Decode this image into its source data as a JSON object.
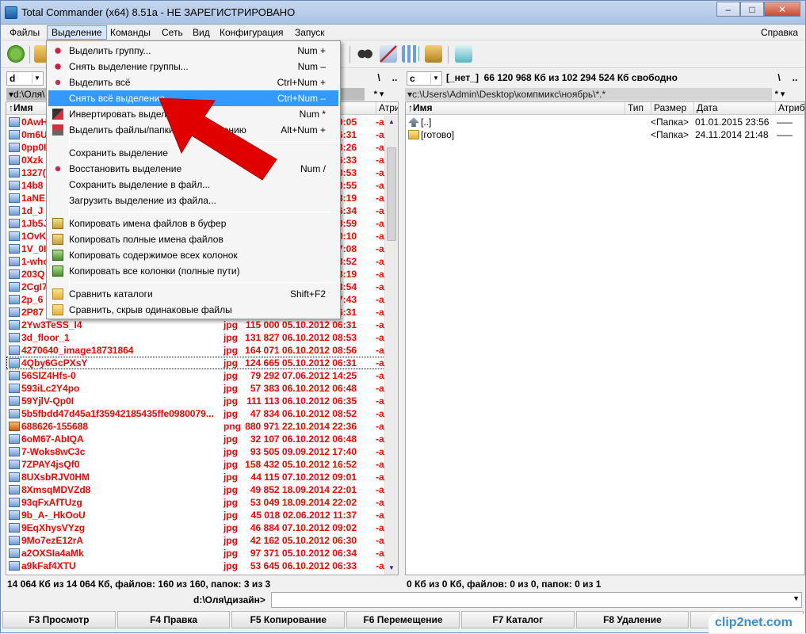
{
  "window": {
    "title": "Total Commander (x64) 8.51a - НЕ ЗАРЕГИСТРИРОВАНО",
    "minimize": "–",
    "maximize": "□",
    "close": "✕"
  },
  "menubar": [
    "Файлы",
    "Выделение",
    "Команды",
    "Сеть",
    "Вид",
    "Конфигурация",
    "Запуск",
    "Справка"
  ],
  "left_drive": {
    "letter": "d",
    "back": "\\",
    "up": ".."
  },
  "right_drive": {
    "letter": "c",
    "label": "[_нет_]",
    "free": "66 120 968 Кб из 102 294 524 Кб свободно",
    "back": "\\",
    "up": ".."
  },
  "left_path": "▾d:\\Оля\\",
  "left_path_right": "* ▾",
  "right_path": "▾c:\\Users\\Admin\\Desktop\\компмикс\\ноябрь\\*.*",
  "right_path_right": "* ▾",
  "left_columns": {
    "name": "↑Имя",
    "attr": "Атри"
  },
  "right_columns": {
    "name": "↑Имя",
    "type": "Тип",
    "size": "Размер",
    "date": "Дата",
    "attr": "Атрибу"
  },
  "left_rows": [
    {
      "name": "0AwH",
      "ext": "",
      "size": "",
      "date": "2012 09:05",
      "attr": "-a-"
    },
    {
      "name": "0m6U",
      "ext": "",
      "size": "",
      "date": "2012 06:31",
      "attr": "-a-"
    },
    {
      "name": "0pp0I",
      "ext": "",
      "size": "",
      "date": "2012 08:26",
      "attr": "-a-"
    },
    {
      "name": "0Xzk",
      "ext": "",
      "size": "",
      "date": "2012 06:33",
      "attr": "-a-"
    },
    {
      "name": "1327(",
      "ext": "",
      "size": "",
      "date": "2012 08:53",
      "attr": "-a-"
    },
    {
      "name": "14b8",
      "ext": "",
      "size": "",
      "date": "2012 08:55",
      "attr": "-a-"
    },
    {
      "name": "1aNE",
      "ext": "",
      "size": "",
      "date": "3 13:19",
      "attr": "-a-"
    },
    {
      "name": "1d_J",
      "ext": "",
      "size": "",
      "date": "2012 06:34",
      "attr": "-a-"
    },
    {
      "name": "1Jb5J",
      "ext": "",
      "size": "",
      "date": "2012 08:59",
      "attr": "-a-"
    },
    {
      "name": "1OvK",
      "ext": "",
      "size": "",
      "date": "2014 20:10",
      "attr": "-a-"
    },
    {
      "name": "1V_0I",
      "ext": "",
      "size": "",
      "date": "2012 07:08",
      "attr": "-a-"
    },
    {
      "name": "1-who",
      "ext": "",
      "size": "",
      "date": "2012 08:52",
      "attr": "-a-"
    },
    {
      "name": "203Q",
      "ext": "",
      "size": "",
      "date": "2012 08:19",
      "attr": "-a-"
    },
    {
      "name": "2CgI7",
      "ext": "",
      "size": "",
      "date": "2012 08:54",
      "attr": "-a-"
    },
    {
      "name": "2p_6",
      "ext": "",
      "size": "",
      "date": "2012 17:43",
      "attr": "-a-"
    },
    {
      "name": "2P87",
      "ext": "",
      "size": "",
      "date": "2012 06:31",
      "attr": "-a-"
    },
    {
      "name": "2Yw3TeSS_I4",
      "ext": "jpg",
      "size": "115 000",
      "date": "05.10.2012 06:31",
      "attr": "-a-"
    },
    {
      "name": "3d_floor_1",
      "ext": "jpg",
      "size": "131 827",
      "date": "06.10.2012 08:53",
      "attr": "-a-"
    },
    {
      "name": "4270640_image18731864",
      "ext": "jpg",
      "size": "164 071",
      "date": "06.10.2012 08:56",
      "attr": "-a-"
    },
    {
      "name": "4Qby6GcPXsY",
      "ext": "jpg",
      "size": "124 665",
      "date": "05.10.2012 06:31",
      "attr": "-a-",
      "cursor": true
    },
    {
      "name": "56SlZ4Hfs-0",
      "ext": "jpg",
      "size": "79 292",
      "date": "07.06.2012 14:25",
      "attr": "-a-"
    },
    {
      "name": "593iLc2Y4po",
      "ext": "jpg",
      "size": "57 383",
      "date": "06.10.2012 06:48",
      "attr": "-a-"
    },
    {
      "name": "59YjlV-Qp0I",
      "ext": "jpg",
      "size": "111 113",
      "date": "06.10.2012 06:35",
      "attr": "-a-"
    },
    {
      "name": "5b5fbdd47d45a1f35942185435ffe0980079...",
      "ext": "jpg",
      "size": "47 834",
      "date": "06.10.2012 08:52",
      "attr": "-a-"
    },
    {
      "name": "688626-155688",
      "ext": "png",
      "size": "880 971",
      "date": "22.10.2014 22:36",
      "attr": "-a-",
      "png": true
    },
    {
      "name": "6oM67-AbIQA",
      "ext": "jpg",
      "size": "32 107",
      "date": "06.10.2012 06:48",
      "attr": "-a-"
    },
    {
      "name": "7-Woks8wC3c",
      "ext": "jpg",
      "size": "93 505",
      "date": "09.09.2012 17:40",
      "attr": "-a-"
    },
    {
      "name": "7ZPAY4jsQf0",
      "ext": "jpg",
      "size": "158 432",
      "date": "05.10.2012 16:52",
      "attr": "-a-"
    },
    {
      "name": "8UXsbRJV0HM",
      "ext": "jpg",
      "size": "44 115",
      "date": "07.10.2012 09:01",
      "attr": "-a-"
    },
    {
      "name": "8XmsqMDVZd8",
      "ext": "jpg",
      "size": "49 852",
      "date": "18.09.2014 22:01",
      "attr": "-a-"
    },
    {
      "name": "93qFxAfTUzg",
      "ext": "jpg",
      "size": "53 049",
      "date": "18.09.2014 22:02",
      "attr": "-a-"
    },
    {
      "name": "9b_A-_HkOoU",
      "ext": "jpg",
      "size": "45 018",
      "date": "02.06.2012 11:37",
      "attr": "-a-"
    },
    {
      "name": "9EqXhysVYzg",
      "ext": "jpg",
      "size": "46 884",
      "date": "07.10.2012 09:02",
      "attr": "-a-"
    },
    {
      "name": "9Mo7ezE12rA",
      "ext": "jpg",
      "size": "42 162",
      "date": "05.10.2012 06:30",
      "attr": "-a-"
    },
    {
      "name": "a2OXSIa4aMk",
      "ext": "jpg",
      "size": "97 371",
      "date": "05.10.2012 06:34",
      "attr": "-a-"
    },
    {
      "name": "a9kFaf4XTU",
      "ext": "jpg",
      "size": "53 645",
      "date": "06.10.2012 06:33",
      "attr": "-a-"
    }
  ],
  "right_rows": [
    {
      "name": "[..]",
      "type": "",
      "size": "<Папка>",
      "date": "01.01.2015 23:56",
      "attr": "——",
      "up": true
    },
    {
      "name": "[готово]",
      "type": "",
      "size": "<Папка>",
      "date": "24.11.2014 21:48",
      "attr": "——"
    }
  ],
  "status_left": "14 064 Кб из 14 064 Кб, файлов: 160 из 160, папок: 3 из 3",
  "status_right": "0 Кб из 0 Кб, файлов: 0 из 0, папок: 0 из 1",
  "cmd_path": "d:\\Оля\\дизайн>",
  "fkeys": [
    "F3 Просмотр",
    "F4 Правка",
    "F5 Копирование",
    "F6 Перемещение",
    "F7 Каталог",
    "F8 Удаление",
    "Alt+F4 Выход"
  ],
  "dropdown": {
    "items": [
      {
        "label": "Выделить группу...",
        "key": "Num +",
        "icon": "plus-select-icon"
      },
      {
        "label": "Снять выделение группы...",
        "key": "Num –",
        "icon": "minus-select-icon"
      },
      {
        "label": "Выделить всё",
        "key": "Ctrl+Num +",
        "icon": "select-all-icon"
      },
      {
        "label": "Снять всё выделение",
        "key": "Ctrl+Num –",
        "icon": "",
        "highlighted": true
      },
      {
        "label": "Инвертировать выделение",
        "key": "Num *",
        "icon": "invert-icon"
      },
      {
        "label": "Выделить файлы/папки по расширению",
        "key": "Alt+Num +",
        "icon": "ext-icon"
      },
      {
        "label": "Сохранить выделение",
        "key": "",
        "icon": "",
        "sep_before": true
      },
      {
        "label": "Восстановить выделение",
        "key": "Num /",
        "icon": "restore-icon"
      },
      {
        "label": "Сохранить выделение в файл...",
        "key": "",
        "icon": ""
      },
      {
        "label": "Загрузить выделение из файла...",
        "key": "",
        "icon": ""
      },
      {
        "label": "Копировать имена файлов в буфер",
        "key": "",
        "icon": "copy-names-icon",
        "sep_before": true
      },
      {
        "label": "Копировать полные имена файлов",
        "key": "",
        "icon": "copy-full-icon"
      },
      {
        "label": "Копировать содержимое всех колонок",
        "key": "",
        "icon": "copy-cols-icon"
      },
      {
        "label": "Копировать все колонки (полные пути)",
        "key": "",
        "icon": "copy-cols-full-icon"
      },
      {
        "label": "Сравнить каталоги",
        "key": "Shift+F2",
        "icon": "compare-icon",
        "sep_before": true
      },
      {
        "label": "Сравнить, скрыв одинаковые файлы",
        "key": "",
        "icon": "compare-hide-icon"
      }
    ]
  },
  "watermark": "clip2net.com",
  "colors": {
    "selected_file": "#ff0000",
    "menu_highlight": "#3399ff",
    "arrow": "#e00000"
  }
}
